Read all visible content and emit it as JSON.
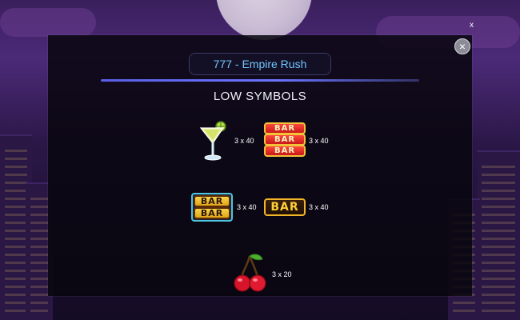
{
  "game": {
    "title": "777 - Empire Rush",
    "close_symbol": "×"
  },
  "overlay": {
    "corner_close": "x"
  },
  "paytable": {
    "heading": "LOW SYMBOLS",
    "symbols": [
      {
        "name": "cocktail-icon",
        "payout": "3 x 40"
      },
      {
        "name": "triple-red-bar-icon",
        "labels": [
          "BAR",
          "BAR",
          "BAR"
        ],
        "payout": "3 x 40"
      },
      {
        "name": "double-bar-icon",
        "labels": [
          "BAR",
          "BAR"
        ],
        "payout": "3 x 40"
      },
      {
        "name": "single-bar-icon",
        "labels": [
          "BAR"
        ],
        "payout": "3 x 40"
      },
      {
        "name": "cherries-icon",
        "payout": "3 x 20"
      }
    ]
  },
  "colors": {
    "title_text": "#6fc7ff",
    "divider": "#5b5fe6",
    "bar_gold": "#f6d44a",
    "bar_red": "#e02020",
    "cherry": "#d8142a"
  }
}
